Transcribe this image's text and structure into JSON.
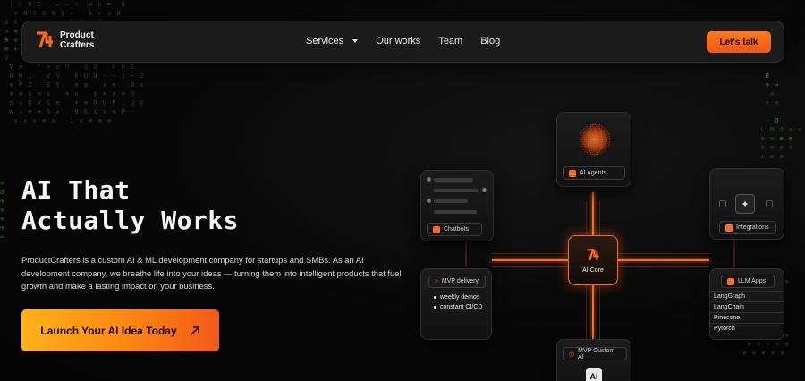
{
  "brand": {
    "name_line1": "Product",
    "name_line2": "Crafters",
    "accent": "#ff6a1a"
  },
  "nav": {
    "items": [
      {
        "label": "Services",
        "has_dropdown": true
      },
      {
        "label": "Our works"
      },
      {
        "label": "Team"
      },
      {
        "label": "Blog"
      }
    ],
    "cta_label": "Let's talk"
  },
  "hero": {
    "title_line1": "AI That",
    "title_line2": "Actually Works",
    "description": "ProductCrafters is a custom AI & ML development company for startups and SMBs. As an AI development company, we breathe life into your ideas — turning them into intelligent products that fuel growth and make a lasting impact on your business.",
    "cta_label": "Launch Your AI Idea Today"
  },
  "diagram": {
    "ai_agents": "AI Agents",
    "chatbots": "Chatbots",
    "integrations": "Integrations",
    "core": "AI Core",
    "mvp_delivery": {
      "title": "MVP delivery",
      "bullets": [
        "weekly demos",
        "constant CI/CD"
      ]
    },
    "llm_apps": {
      "title": "LLM Apps",
      "items": [
        "LangGraph",
        "LangChain",
        "Pinecone",
        "Pytorch"
      ]
    },
    "mvp_custom_ai": "MVP Custom AI",
    "ai_badge": "AI"
  }
}
